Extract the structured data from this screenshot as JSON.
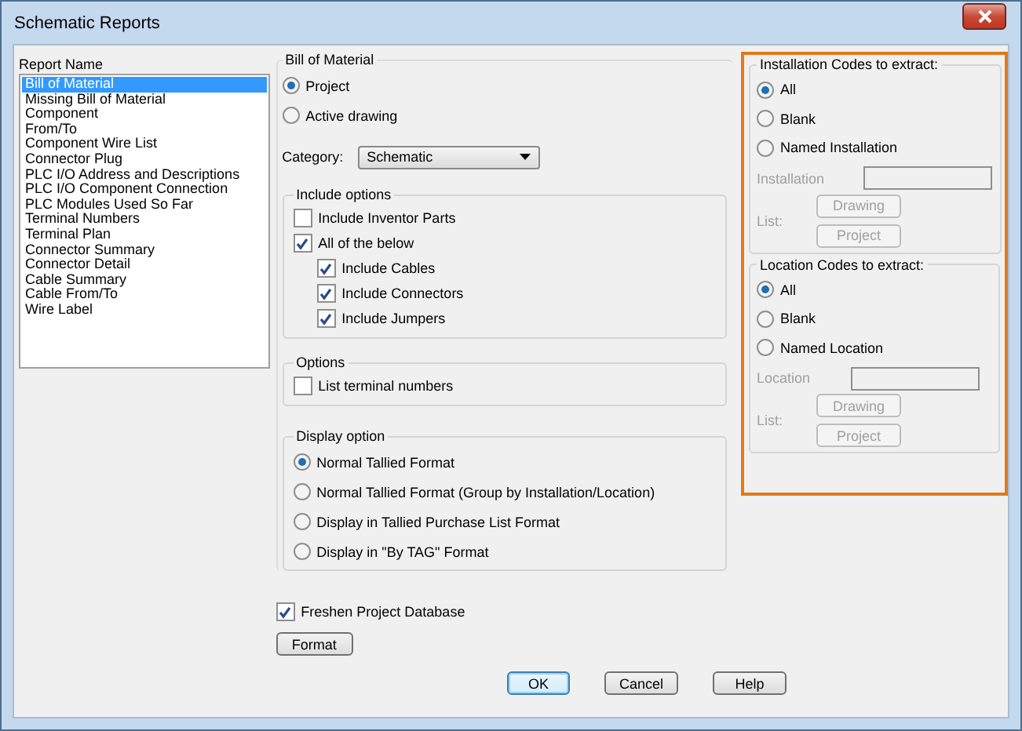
{
  "window": {
    "title": "Schematic Reports"
  },
  "report_list": {
    "header": "Report Name",
    "items": [
      {
        "label": "Bill of Material",
        "selected": true
      },
      {
        "label": "Missing Bill of Material",
        "selected": false
      },
      {
        "label": "Component",
        "selected": false
      },
      {
        "label": "From/To",
        "selected": false
      },
      {
        "label": "Component Wire List",
        "selected": false
      },
      {
        "label": "Connector Plug",
        "selected": false
      },
      {
        "label": "PLC I/O Address and Descriptions",
        "selected": false
      },
      {
        "label": "PLC I/O Component Connection",
        "selected": false
      },
      {
        "label": "PLC Modules Used So Far",
        "selected": false
      },
      {
        "label": "Terminal Numbers",
        "selected": false
      },
      {
        "label": "Terminal Plan",
        "selected": false
      },
      {
        "label": "Connector Summary",
        "selected": false
      },
      {
        "label": "Connector Detail",
        "selected": false
      },
      {
        "label": "Cable Summary",
        "selected": false
      },
      {
        "label": "Cable From/To",
        "selected": false
      },
      {
        "label": "Wire Label",
        "selected": false
      }
    ]
  },
  "bill_of_material": {
    "title": "Bill of Material",
    "scope_options": [
      {
        "label": "Project",
        "selected": true
      },
      {
        "label": "Active drawing",
        "selected": false
      }
    ],
    "category": {
      "label": "Category:",
      "value": "Schematic"
    }
  },
  "include_options": {
    "title": "Include options",
    "items": [
      {
        "label": "Include Inventor Parts",
        "checked": false
      },
      {
        "label": "All of the below",
        "checked": true,
        "children": [
          {
            "label": "Include Cables",
            "checked": true
          },
          {
            "label": "Include Connectors",
            "checked": true
          },
          {
            "label": "Include Jumpers",
            "checked": true
          }
        ]
      }
    ]
  },
  "options": {
    "title": "Options",
    "items": [
      {
        "label": "List terminal numbers",
        "checked": false
      }
    ]
  },
  "display_option": {
    "title": "Display option",
    "options": [
      {
        "label": "Normal Tallied Format",
        "selected": true
      },
      {
        "label": "Normal Tallied Format (Group by Installation/Location)",
        "selected": false
      },
      {
        "label": "Display in Tallied Purchase List Format",
        "selected": false
      },
      {
        "label": "Display in \"By TAG\" Format",
        "selected": false
      }
    ]
  },
  "freshen": {
    "label": "Freshen Project Database",
    "checked": true
  },
  "format_button": "Format",
  "code_sections": [
    {
      "title": "Installation Codes to extract:",
      "options": [
        {
          "label": "All",
          "selected": true
        },
        {
          "label": "Blank",
          "selected": false
        },
        {
          "label": "Named Installation",
          "selected": false
        }
      ],
      "field_label": "Installation",
      "list_label": "List:",
      "buttons": [
        "Drawing",
        "Project"
      ],
      "disabled": true
    },
    {
      "title": "Location Codes to extract:",
      "options": [
        {
          "label": "All",
          "selected": true
        },
        {
          "label": "Blank",
          "selected": false
        },
        {
          "label": "Named Location",
          "selected": false
        }
      ],
      "field_label": "Location",
      "list_label": "List:",
      "buttons": [
        "Drawing",
        "Project"
      ],
      "disabled": true
    }
  ],
  "footer_buttons": [
    {
      "label": "OK",
      "default": true
    },
    {
      "label": "Cancel",
      "default": false
    },
    {
      "label": "Help",
      "default": false
    }
  ]
}
